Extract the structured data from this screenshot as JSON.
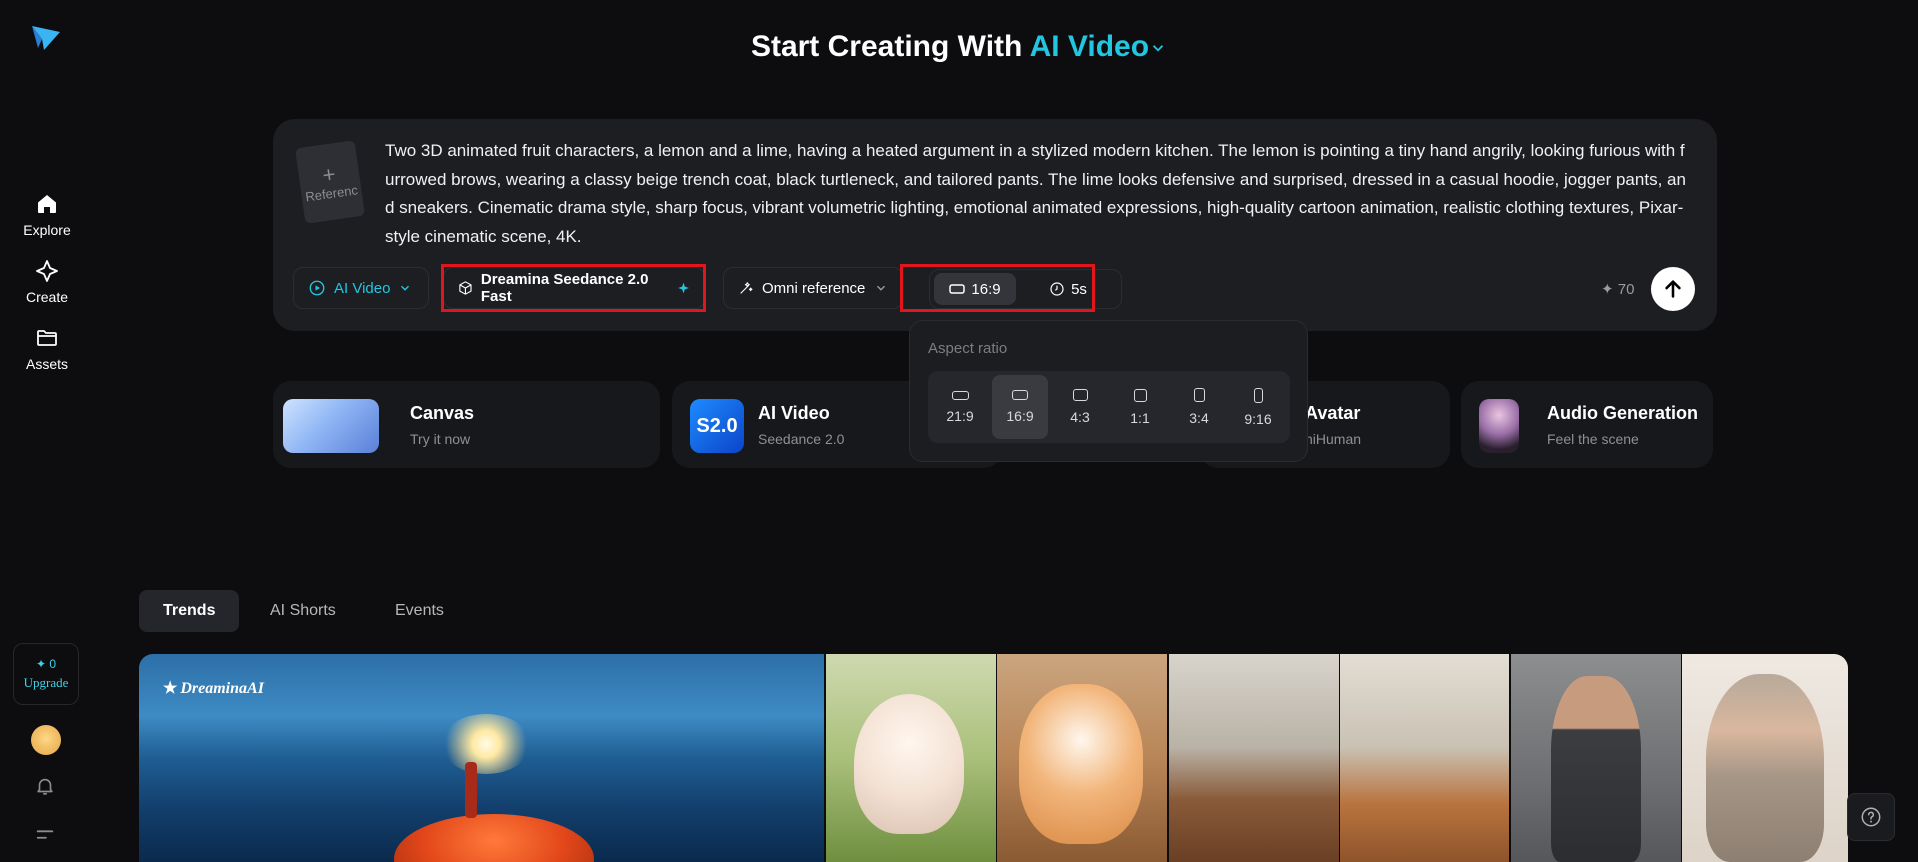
{
  "sidebar": {
    "items": [
      {
        "label": "Explore",
        "icon": "home-icon"
      },
      {
        "label": "Create",
        "icon": "sparkle-icon"
      },
      {
        "label": "Assets",
        "icon": "folder-icon"
      }
    ],
    "upgrade": {
      "credits": "✦ 0",
      "label": "Upgrade"
    }
  },
  "header": {
    "title_prefix": "Start Creating With",
    "title_accent": "AI Video"
  },
  "prompt": {
    "reference_label": "Referenc",
    "text": "Two 3D animated fruit characters, a lemon and a lime, having a heated argument in a stylized modern kitchen. The lemon is pointing a tiny hand angrily, looking furious with furrowed brows, wearing a classy beige trench coat, black turtleneck, and tailored pants. The lime looks defensive and surprised, dressed in a casual hoodie, jogger pants, and sneakers. Cinematic drama style, sharp focus, vibrant volumetric lighting, emotional animated expressions, high-quality cartoon animation, realistic clothing textures, Pixar-style cinematic scene, 4K.",
    "toolbar": {
      "mode": "AI Video",
      "model": "Dreamina Seedance 2.0 Fast",
      "reference": "Omni reference",
      "ratio": "16:9",
      "duration": "5s",
      "credits": "✦ 70"
    }
  },
  "aspect_popup": {
    "title": "Aspect ratio",
    "options": [
      "21:9",
      "16:9",
      "4:3",
      "1:1",
      "3:4",
      "9:16"
    ],
    "selected": "16:9"
  },
  "features": [
    {
      "title": "Canvas",
      "subtitle": "Try it now"
    },
    {
      "title": "AI Video",
      "subtitle": "Seedance 2.0"
    },
    {
      "title": "Avatar",
      "subtitle": "niHuman"
    },
    {
      "title": "Audio Generation",
      "subtitle": "Feel the scene"
    }
  ],
  "tabs": [
    "Trends",
    "AI Shorts",
    "Events"
  ],
  "gallery": {
    "watermark": "DreaminaAI"
  },
  "colors": {
    "accent": "#22c6e0",
    "highlight": "#e0161c",
    "background": "#0d0d0f"
  }
}
